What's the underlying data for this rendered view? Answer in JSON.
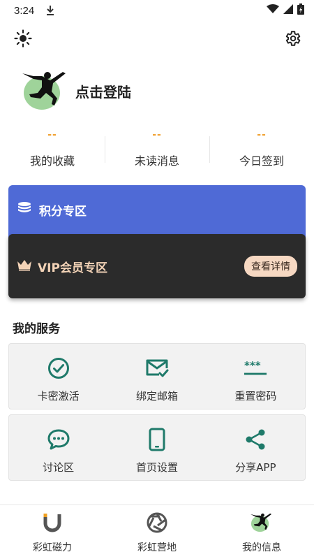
{
  "status_bar": {
    "time": "3:24"
  },
  "profile": {
    "login_text": "点击登陆"
  },
  "stats": [
    {
      "value": "--",
      "label": "我的收藏"
    },
    {
      "value": "--",
      "label": "未读消息"
    },
    {
      "value": "--",
      "label": "今日签到"
    }
  ],
  "points_card": {
    "label": "积分专区"
  },
  "vip_card": {
    "label": "VIP会员专区",
    "button": "查看详情"
  },
  "services": {
    "title": "我的服务",
    "items": [
      {
        "label": "卡密激活",
        "icon": "check-circle-icon"
      },
      {
        "label": "绑定邮箱",
        "icon": "mail-check-icon"
      },
      {
        "label": "重置密码",
        "icon": "password-icon"
      },
      {
        "label": "讨论区",
        "icon": "chat-bubble-icon"
      },
      {
        "label": "首页设置",
        "icon": "phone-icon"
      },
      {
        "label": "分享APP",
        "icon": "share-icon"
      }
    ]
  },
  "bottom_nav": [
    {
      "label": "彩虹磁力",
      "icon": "magnet-icon"
    },
    {
      "label": "彩虹营地",
      "icon": "aperture-icon"
    },
    {
      "label": "我的信息",
      "icon": "avatar-icon"
    }
  ],
  "colors": {
    "accent_teal": "#1f7a6a",
    "points_blue": "#4f6ad6",
    "vip_dark": "#2b2b2b",
    "vip_gold": "#f3d3b7",
    "stat_orange": "#f0a030"
  }
}
